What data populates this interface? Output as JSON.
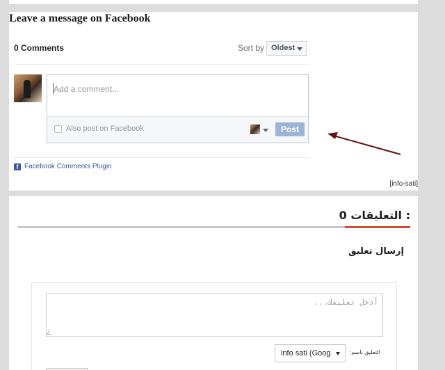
{
  "facebook": {
    "heading": "Leave a message on Facebook",
    "comments_count": "0 Comments",
    "sort_label": "Sort by",
    "sort_value": "Oldest",
    "comment_placeholder": "Add a comment...",
    "also_post_label": "Also post on Facebook",
    "post_button": "Post",
    "plugin_label": "Facebook Comments Plugin",
    "plugin_icon": "facebook-icon"
  },
  "credit": "[info-sati]",
  "blogger": {
    "comments_heading": "0 التعليقات :",
    "post_comment_heading": "إرسال تعليق",
    "textarea_placeholder": "أدخل تعليقك...",
    "comment_as_label": "التعليق باسم:",
    "identity_value": "info sati (Goog"
  },
  "colors": {
    "accent": "#d44a2e",
    "fb_blue": "#3b5998",
    "post_button": "#9cb4d8",
    "arrow": "#6b0e0e"
  }
}
